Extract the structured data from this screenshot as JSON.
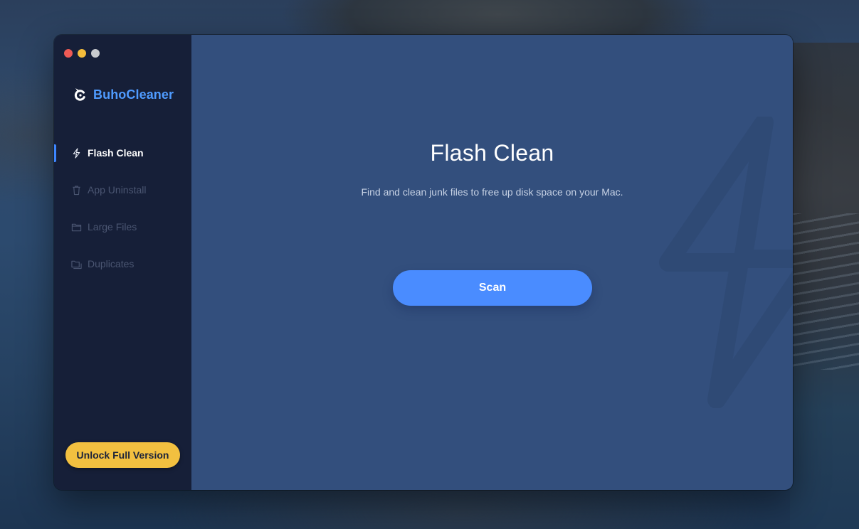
{
  "app": {
    "name": "BuhoCleaner"
  },
  "sidebar": {
    "items": [
      {
        "label": "Flash Clean",
        "icon": "lightning-icon",
        "active": true
      },
      {
        "label": "App Uninstall",
        "icon": "trash-icon",
        "active": false
      },
      {
        "label": "Large Files",
        "icon": "folder-icon",
        "active": false
      },
      {
        "label": "Duplicates",
        "icon": "duplicate-folder-icon",
        "active": false
      }
    ],
    "unlock_label": "Unlock Full Version"
  },
  "main": {
    "title": "Flash Clean",
    "subtitle": "Find and clean junk files to free up disk space on your Mac.",
    "scan_label": "Scan"
  },
  "colors": {
    "accent": "#4a8cff",
    "brand": "#4f9bff",
    "unlock": "#f2c040",
    "sidebar_bg": "#161f38",
    "main_bg": "#334f7d"
  }
}
